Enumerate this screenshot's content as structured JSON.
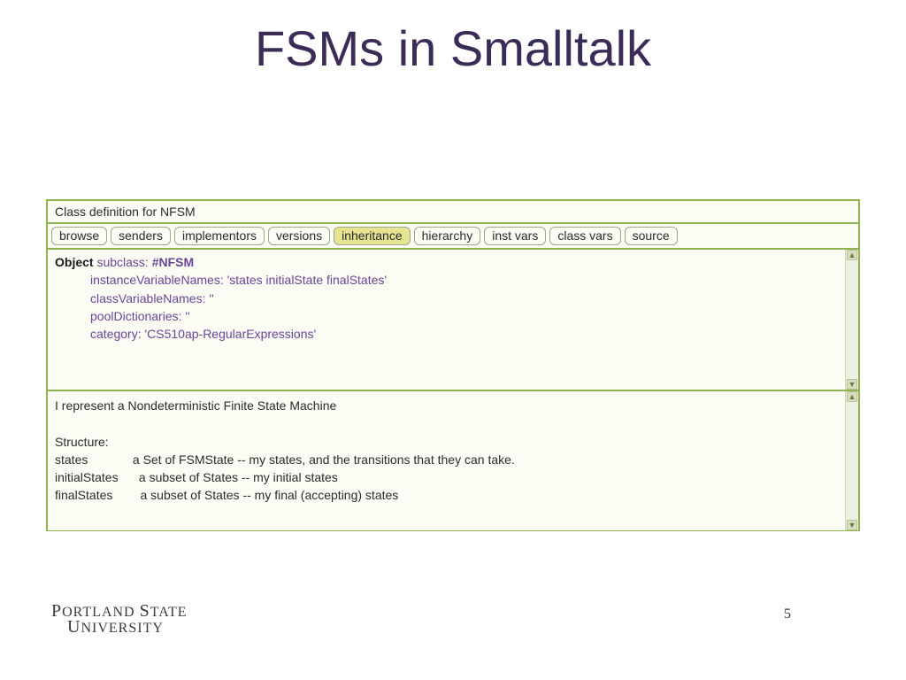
{
  "title": "FSMs in Smalltalk",
  "window": {
    "header": "Class definition for NFSM",
    "buttons": [
      {
        "label": "browse",
        "selected": false
      },
      {
        "label": "senders",
        "selected": false
      },
      {
        "label": "implementors",
        "selected": false
      },
      {
        "label": "versions",
        "selected": false
      },
      {
        "label": "inheritance",
        "selected": true
      },
      {
        "label": "hierarchy",
        "selected": false
      },
      {
        "label": "inst vars",
        "selected": false
      },
      {
        "label": "class vars",
        "selected": false
      },
      {
        "label": "source",
        "selected": false
      }
    ],
    "code": {
      "object": "Object",
      "subclass_kw": " subclass: ",
      "class_name": "#NFSM",
      "lines": [
        {
          "kw": "instanceVariableNames:",
          "str": "'states initialState finalStates'"
        },
        {
          "kw": "classVariableNames:",
          "str": "''"
        },
        {
          "kw": "poolDictionaries:",
          "str": "''"
        },
        {
          "kw": "category:",
          "str": "'CS510ap-RegularExpressions'"
        }
      ]
    },
    "comment": "I represent a Nondeterministic Finite State Machine\n\nStructure:\nstates             a Set of FSMState -- my states, and the transitions that they can take.\ninitialStates      a subset of States -- my initial states\nfinalStates        a subset of States -- my final (accepting) states"
  },
  "footer": {
    "logo_line1_a": "P",
    "logo_line1_b": "ORTLAND ",
    "logo_line1_c": "S",
    "logo_line1_d": "TATE",
    "logo_line2_a": "U",
    "logo_line2_b": "NIVERSITY"
  },
  "page_number": "5"
}
